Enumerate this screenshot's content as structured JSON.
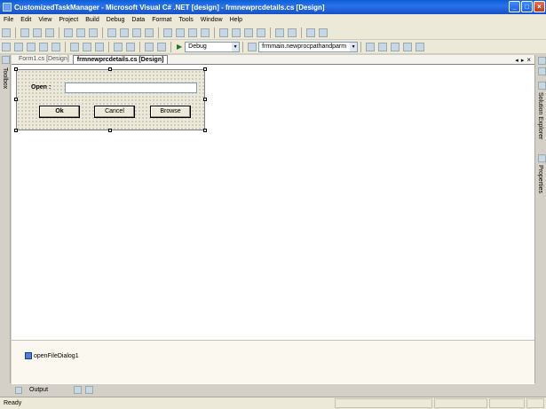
{
  "window": {
    "title": "CustomizedTaskManager - Microsoft Visual C# .NET [design] - frmnewprcdetails.cs [Design]",
    "minimize_glyph": "_",
    "maximize_glyph": "□",
    "close_glyph": "×",
    "title_bar_color": "#0a5fd8"
  },
  "menu": {
    "items": [
      "File",
      "Edit",
      "View",
      "Project",
      "Build",
      "Debug",
      "Data",
      "Format",
      "Tools",
      "Window",
      "Help"
    ]
  },
  "toolbar": {
    "config_combo": "Debug",
    "startup_combo": "frmmain.newprocpathandparm",
    "start_glyph": "▶"
  },
  "left_dock": {
    "label": "Toolbox"
  },
  "right_dock": {
    "solution_explorer": "Solution Explorer",
    "properties": "Properties"
  },
  "tabs": {
    "items": [
      {
        "label": "Form1.cs [Design]",
        "active": false
      },
      {
        "label": "frmnewprcdetails.cs [Design]",
        "active": true
      }
    ],
    "scroll_left": "◂",
    "scroll_right": "▸",
    "close": "×"
  },
  "form": {
    "open_label": "Open :",
    "path_value": "",
    "ok_label": "Ok",
    "cancel_label": "Cancel",
    "browse_label": "Browse"
  },
  "tray": {
    "components": [
      "openFileDialog1"
    ]
  },
  "output": {
    "label": "Output"
  },
  "status": {
    "text": "Ready"
  }
}
